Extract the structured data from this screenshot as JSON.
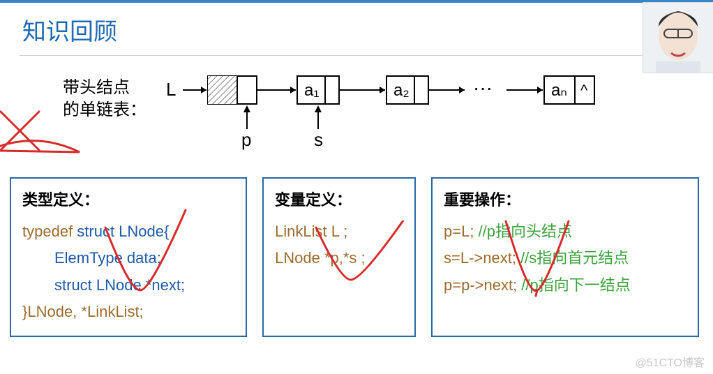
{
  "title": "知识回顾",
  "diagram_label": "带头结点\n的单链表：",
  "diagram": {
    "L": "L",
    "a1": "a₁",
    "a2": "a₂",
    "an": "aₙ",
    "term": "^",
    "dots": "···",
    "p": "p",
    "s": "s"
  },
  "panels": {
    "typedef": {
      "heading": "类型定义：",
      "l1_a": "typedef",
      "l1_b": "  struct   LNode{",
      "l2": "ElemType        data;",
      "l3": "struct   LNode   *next;",
      "l4_a": "}LNode, *LinkList;"
    },
    "vardef": {
      "heading": "变量定义：",
      "l1": "LinkList   L  ;",
      "l2": "LNode *p,*s  ;"
    },
    "opdef": {
      "heading": "重要操作：",
      "l1_a": "p=L;",
      "l1_b": " //p指向头结点",
      "l2_a": "s=L->next;",
      "l2_b": " //s指向首元结点",
      "l3_a": "p=p->next;",
      "l3_b": " //p指向下一结点"
    }
  },
  "watermark": "@51CTO博客"
}
